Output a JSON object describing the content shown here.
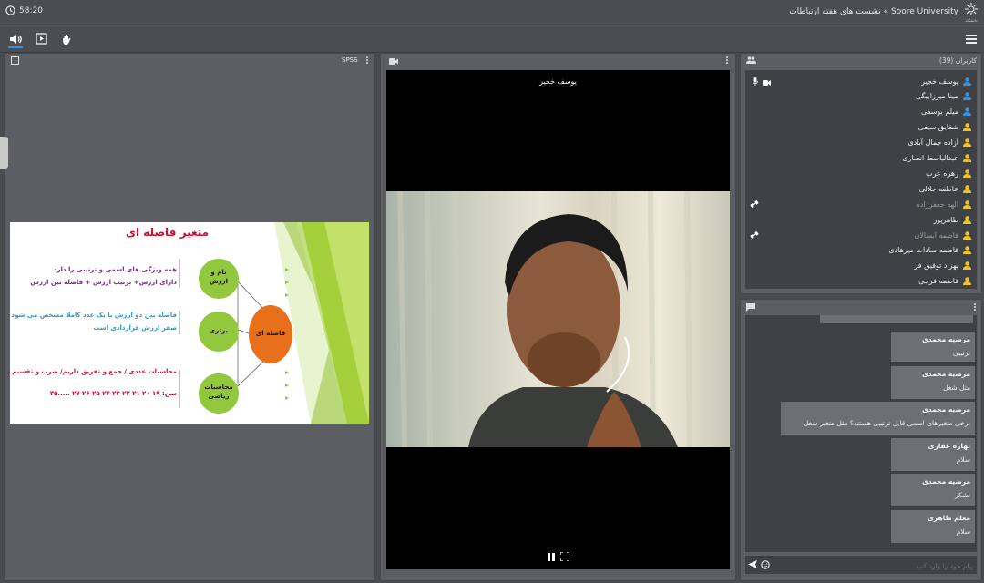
{
  "header": {
    "time": "58:20",
    "title": "Soore University » نشست های هفته ارتباطات",
    "logo_text": "دانشگاه"
  },
  "toolbar": {
    "speaker": "speaker-icon",
    "play": "play-icon",
    "hand": "hand-raise-icon",
    "menu": "menu-icon"
  },
  "presentation": {
    "label": "SPSS",
    "slide": {
      "title": "متغیر فاصله ای",
      "bullet1": [
        "همه ویژگی های اسمی و ترتیبی را دارد",
        "دارای ارزش+ ترتیب ارزش + فاصله بین ارزش"
      ],
      "bullet2": [
        "فاصله بین دو ارزش با یک عدد کاملا مشخص می شود",
        "صفر ارزش قراردادی است"
      ],
      "bullet3": [
        "محاسبات عددی / جمع و تفریق داریم/ ضرب و تقسیم داریم",
        "سن: ۱۹  ۲۰  ۲۱  ۲۲  ۲۳  ۲۴  ۲۵  ۲۶  ۲۷  .....۳۵"
      ],
      "circle1": [
        "نام و",
        "ارزش"
      ],
      "circle2": "برتری",
      "circle3": [
        "محاسبات",
        "ریاضی"
      ],
      "center": "فاصله ای"
    }
  },
  "video": {
    "speaker_name": "یوسف خجیر"
  },
  "users": {
    "title": "کاربران (39)",
    "list": [
      {
        "name": "یوسف خجیر",
        "color": "#3b8fe0",
        "mic": true,
        "cam": true
      },
      {
        "name": "مینا میرزابیگی",
        "color": "#3b8fe0"
      },
      {
        "name": "میلم یوسفی",
        "color": "#3b8fe0"
      },
      {
        "name": "شقایق سیفی",
        "color": "#f0c419"
      },
      {
        "name": "آزاده جمال آبادی",
        "color": "#f0c419"
      },
      {
        "name": "عبدالباسط انصاری",
        "color": "#f0c419"
      },
      {
        "name": "زهره عرب",
        "color": "#f0c419"
      },
      {
        "name": "عاطفه جلالی",
        "color": "#f0c419"
      },
      {
        "name": "الهه جعفرزاده",
        "color": "#f0c419",
        "dim": true,
        "left_icon": true
      },
      {
        "name": "طاهرپور",
        "color": "#f0c419"
      },
      {
        "name": "فاطمه ابسالان",
        "color": "#f0c419",
        "dim": true,
        "left_icon": true
      },
      {
        "name": "فاطمه سادات میرهادی",
        "color": "#f0c419"
      },
      {
        "name": "بهزاد توفیق فر",
        "color": "#f0c419"
      },
      {
        "name": "فاطمه فرجی",
        "color": "#f0c419"
      }
    ]
  },
  "chat": {
    "messages": [
      {
        "name": "مرضیه محمدی",
        "text": "ترتیبی"
      },
      {
        "name": "مرضیه محمدی",
        "text": "مثل شغل"
      },
      {
        "name": "مرضیه محمدی",
        "text": "برخی متغیرهای اسمی قابل ترتیبی هستند؟ مثل متغیر   شغل"
      },
      {
        "name": "بهاره غفاری",
        "text": "سلام"
      },
      {
        "name": "مرضیه محمدی",
        "text": "تشکر"
      },
      {
        "name": "معلم طاهری",
        "text": "سلام"
      }
    ],
    "placeholder": "پیام خود را وارد کنید"
  }
}
